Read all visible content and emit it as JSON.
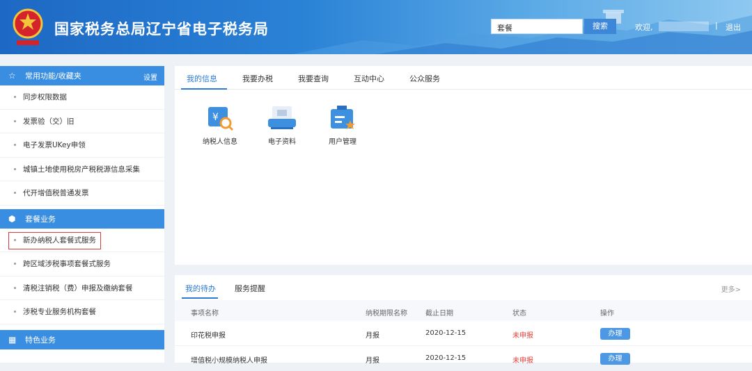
{
  "header": {
    "title": "国家税务总局辽宁省电子税务局",
    "search_value": "套餐",
    "search_button": "搜索",
    "welcome": "欢迎,",
    "separator": "|",
    "logout": "退出"
  },
  "sidebar": {
    "favorites": {
      "title": "常用功能/收藏夹",
      "settings": "设置",
      "items": [
        "同步权限数据",
        "发票验（交）旧",
        "电子发票UKey申领",
        "城镇土地使用税房产税税源信息采集",
        "代开增值税普通发票"
      ]
    },
    "packages": {
      "title": "套餐业务",
      "items": [
        "新办纳税人套餐式服务",
        "跨区域涉税事项套餐式服务",
        "清税注销税（费）申报及缴纳套餐",
        "涉税专业服务机构套餐"
      ]
    },
    "special": {
      "title": "特色业务"
    }
  },
  "main": {
    "tabs": [
      "我的信息",
      "我要办税",
      "我要查询",
      "互动中心",
      "公众服务"
    ],
    "tiles": [
      {
        "label": "纳税人信息",
        "icon": "taxpayer-info-icon"
      },
      {
        "label": "电子资料",
        "icon": "e-documents-icon"
      },
      {
        "label": "用户管理",
        "icon": "user-management-icon"
      }
    ]
  },
  "todo": {
    "tabs": [
      "我的待办",
      "服务提醒"
    ],
    "more": "更多>",
    "columns": [
      "事项名称",
      "纳税期限名称",
      "截止日期",
      "状态",
      "操作"
    ],
    "rows": [
      {
        "name": "印花税申报",
        "period": "月报",
        "deadline": "2020-12-15",
        "status": "未申报",
        "action": "办理"
      },
      {
        "name": "增值税小规模纳税人申报",
        "period": "月报",
        "deadline": "2020-12-15",
        "status": "未申报",
        "action": "办理"
      }
    ]
  },
  "colors": {
    "accent": "#2a7bd6",
    "sidebar_header": "#3a8ee2",
    "status_red": "#e8413a",
    "highlight_border": "#d9393b"
  }
}
